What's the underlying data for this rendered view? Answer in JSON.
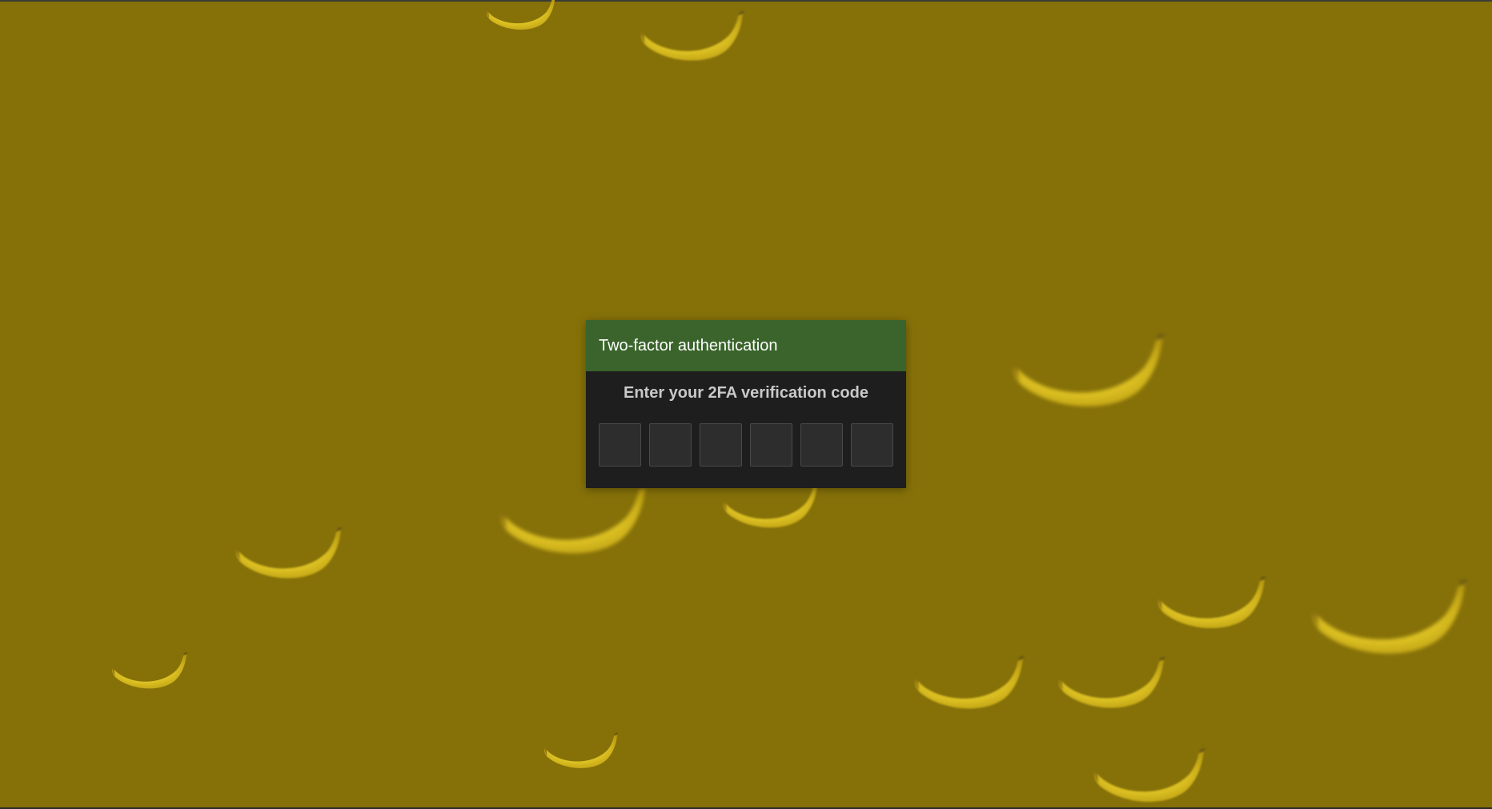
{
  "dialog": {
    "title": "Two-factor authentication",
    "prompt": "Enter your 2FA verification code",
    "code_digits": [
      "",
      "",
      "",
      "",
      "",
      ""
    ]
  },
  "colors": {
    "background": "#867109",
    "header": "#3a642b",
    "dialog_body": "#1e1e1e",
    "banana_yellow": "#e8cf22"
  },
  "decorations": {
    "icon": "banana-icon"
  }
}
